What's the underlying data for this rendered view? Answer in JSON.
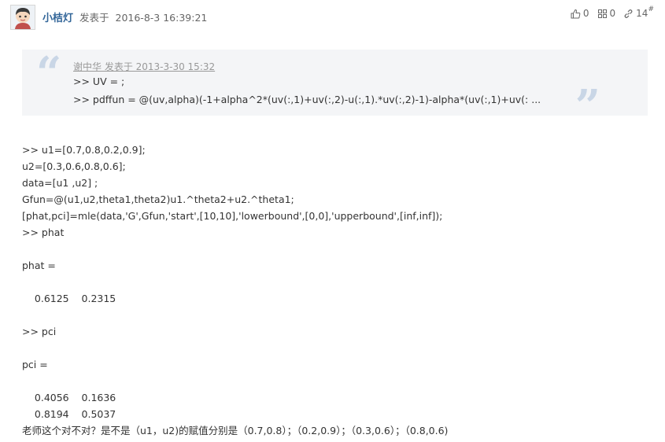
{
  "post": {
    "author": "小桔灯",
    "posted_label": "发表于",
    "timestamp": "2016-8-3 16:39:21",
    "likes": "0",
    "dislikes": "0",
    "floor": "14",
    "floor_mark": "#"
  },
  "quote": {
    "meta": "谢中华 发表于 2013-3-30 15:32",
    "line1": ">> UV = ;",
    "line2": ">> pdffun = @(uv,alpha)(-1+alpha^2*(uv(:,1)+uv(:,2)-u(:,1).*uv(:,2)-1)-alpha*(uv(:,1)+uv(: ..."
  },
  "content_lines": [
    ">> u1=[0.7,0.8,0.2,0.9];",
    "u2=[0.3,0.6,0.8,0.6];",
    "data=[u1 ,u2] ;",
    "Gfun=@(u1,u2,theta1,theta2)u1.^theta2+u2.^theta1;",
    "[phat,pci]=mle(data,'G',Gfun,'start',[10,10],'lowerbound',[0,0],'upperbound',[inf,inf]);",
    ">> phat",
    "",
    "phat =",
    "",
    "    0.6125    0.2315",
    "",
    ">> pci",
    "",
    "pci =",
    "",
    "    0.4056    0.1636",
    "    0.8194    0.5037",
    "老师这个对不对？是不是（u1，u2)的赋值分别是（0.7,0.8）；（0.2,0.9）；（0.3,0.6）；（0.8,0.6)"
  ],
  "colors": {
    "author": "#336699",
    "quote_bg": "#f4f5f7",
    "quote_mark": "#c9d6e6"
  },
  "icons": [
    "avatar",
    "thumbs-up-icon",
    "thumbs-down-icon",
    "link-icon"
  ]
}
